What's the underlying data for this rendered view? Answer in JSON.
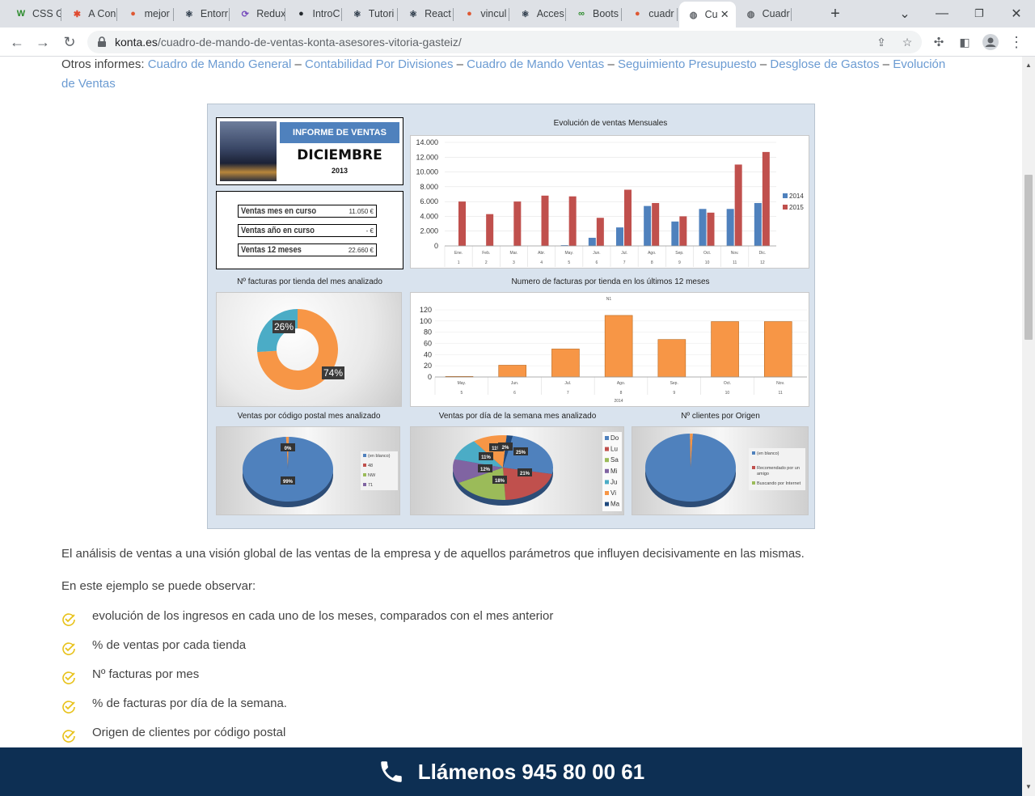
{
  "browser": {
    "tabs": [
      {
        "label": "CSS G",
        "icon": "w-icon"
      },
      {
        "label": "A Con",
        "icon": "asterisk-icon"
      },
      {
        "label": "mejor",
        "icon": "duckduckgo-icon"
      },
      {
        "label": "Entorr",
        "icon": "react-icon"
      },
      {
        "label": "Redux",
        "icon": "redux-icon"
      },
      {
        "label": "IntroC",
        "icon": "github-icon"
      },
      {
        "label": "Tutori",
        "icon": "react-icon"
      },
      {
        "label": "React",
        "icon": "react-icon"
      },
      {
        "label": "vincul",
        "icon": "duckduckgo-icon"
      },
      {
        "label": "Acces",
        "icon": "react-icon"
      },
      {
        "label": "Boots",
        "icon": "bootstrap-icon"
      },
      {
        "label": "cuadr",
        "icon": "duckduckgo-icon"
      },
      {
        "label": "Cu",
        "icon": "globe-icon",
        "active": true
      },
      {
        "label": "Cuadr",
        "icon": "globe-icon"
      }
    ],
    "url_domain": "konta.es",
    "url_path": "/cuadro-de-mando-de-ventas-konta-asesores-vitoria-gasteiz/"
  },
  "page": {
    "other_reports_prefix": "Otros informes:",
    "links": [
      "Cuadro de Mando General",
      "Contabilidad Por Divisiones",
      "Cuadro de Mando Ventas",
      "Seguimiento Presupuesto",
      "Desglose de Gastos",
      "Evolución de Ventas"
    ],
    "link_sep": "–",
    "paragraph1": "El análisis de ventas a una visión global de las ventas de la empresa y de aquellos parámetros que influyen decisivamente en las mismas.",
    "paragraph2": "En este ejemplo se puede observar:",
    "bullets": [
      "evolución de los ingresos en cada uno de los meses, comparados con el mes anterior",
      "% de ventas por cada tienda",
      "Nº facturas por mes",
      "%  de facturas por día de la semana.",
      "Origen de clientes por código postal"
    ],
    "call_label": "Llámenos 945 80 00 61"
  },
  "report": {
    "header_title": "INFORME DE VENTAS",
    "month": "DICIEMBRE",
    "year": "2013",
    "kpis": [
      {
        "label": "Ventas mes en curso",
        "value": "11.050 €"
      },
      {
        "label": "Ventas año en curso",
        "value": "- €"
      },
      {
        "label": "Ventas 12 meses",
        "value": "22.660 €"
      }
    ],
    "colors": {
      "blue": "#4f81bd",
      "red": "#c0504d",
      "orange": "#f79646",
      "teal": "#4bacc6",
      "green": "#9bbb59",
      "purple": "#8064a2",
      "navy": "#1f497d"
    }
  },
  "chart_data": [
    {
      "type": "bar",
      "title": "Evolución de ventas Mensuales",
      "categories": [
        "Ene.",
        "Feb.",
        "Mar.",
        "Abr.",
        "May.",
        "Jun.",
        "Jul.",
        "Ago.",
        "Sep.",
        "Oct.",
        "Nov.",
        "Dic."
      ],
      "category_numbers": [
        "1",
        "2",
        "3",
        "4",
        "5",
        "6",
        "7",
        "8",
        "9",
        "10",
        "11",
        "12"
      ],
      "series": [
        {
          "name": "2014",
          "values": [
            0,
            0,
            0,
            0,
            100,
            1100,
            2500,
            5400,
            3300,
            5000,
            5000,
            5800
          ]
        },
        {
          "name": "2015",
          "values": [
            6000,
            4300,
            6000,
            6800,
            6700,
            3800,
            7600,
            5800,
            4000,
            4500,
            11000,
            12700
          ]
        }
      ],
      "ylim": [
        0,
        14000
      ],
      "yticks": [
        "14.000",
        "12.000",
        "10.000",
        "8.000",
        "6.000",
        "4.000",
        "2.000",
        "0"
      ],
      "legend": "right"
    },
    {
      "type": "pie",
      "title": "Nº facturas por tienda del mes analizado",
      "labels": [
        "26%",
        "74%"
      ],
      "values": [
        26,
        74
      ]
    },
    {
      "type": "bar",
      "title": "Numero de facturas por tienda en los últimos 12 meses",
      "series_label": "N1",
      "categories": [
        "May.",
        "Jun.",
        "Jul.",
        "Ago.",
        "Sep.",
        "Oct.",
        "Nov."
      ],
      "category_numbers": [
        "5",
        "6",
        "7",
        "8",
        "9",
        "10",
        "11"
      ],
      "group_label": "2014",
      "values": [
        1,
        21,
        50,
        110,
        67,
        99,
        99
      ],
      "ylim": [
        0,
        120
      ],
      "yticks": [
        "120",
        "100",
        "80",
        "60",
        "40",
        "20",
        "0"
      ]
    },
    {
      "type": "pie",
      "title": "Ventas por código postal mes analizado",
      "labels": [
        "0%",
        "99%"
      ],
      "values": [
        1,
        99
      ],
      "legend": [
        "(en blanco)",
        "48",
        "NW",
        "71"
      ]
    },
    {
      "type": "pie",
      "title": "Ventas por día de la semana mes analizado",
      "labels": [
        "25%",
        "21%",
        "18%",
        "12%",
        "11%",
        "11%",
        "2%"
      ],
      "values": [
        25,
        21,
        18,
        12,
        11,
        11,
        2
      ],
      "legend": [
        "Do",
        "Lu",
        "Sa",
        "Mi",
        "Ju",
        "Vi",
        "Ma"
      ]
    },
    {
      "type": "pie",
      "title": "Nº clientes por Origen",
      "values": [
        99,
        1
      ],
      "legend": [
        "(en blanco)",
        "Recomendado por un amigo",
        "Buscando por Internet"
      ]
    }
  ]
}
